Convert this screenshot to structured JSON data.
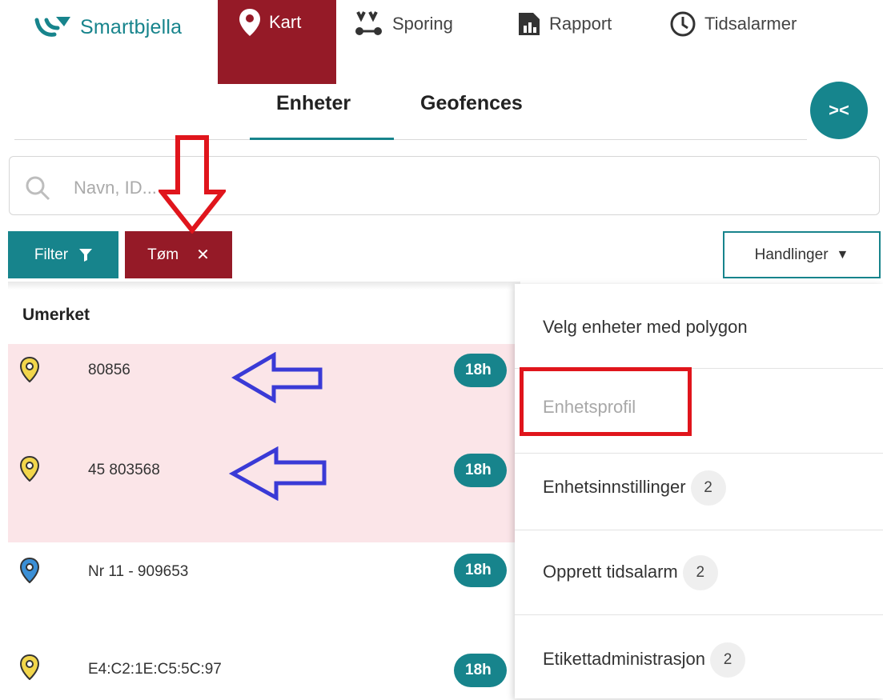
{
  "nav": {
    "logo_text": "Smartbjella",
    "items": [
      {
        "label": "Kart",
        "icon": "map-pin-icon"
      },
      {
        "label": "Sporing",
        "icon": "route-icon"
      },
      {
        "label": "Rapport",
        "icon": "report-icon"
      },
      {
        "label": "Tidsalarmer",
        "icon": "clock-icon"
      }
    ]
  },
  "tabs": [
    {
      "label": "Enheter",
      "active": true
    },
    {
      "label": "Geofences",
      "active": false
    }
  ],
  "collapse_label": "><",
  "search": {
    "placeholder": "Navn, ID..."
  },
  "buttons": {
    "filter": "Filter",
    "clear": "Tøm",
    "actions": "Handlinger"
  },
  "section_title": "Umerket",
  "units": [
    {
      "name": "80856",
      "badge": "18h",
      "pin_color": "#f2d64b",
      "highlighted": true
    },
    {
      "name": "45 803568",
      "badge": "18h",
      "pin_color": "#f2d64b",
      "highlighted": true
    },
    {
      "name": "Nr 11 - 909653",
      "badge": "18h",
      "pin_color": "#3a8fd6",
      "highlighted": false
    },
    {
      "name": "E4:C2:1E:C5:5C:97",
      "badge": "18h",
      "pin_color": "#f2d64b",
      "highlighted": false
    }
  ],
  "menu": [
    {
      "label": "Velg enheter med polygon",
      "count": null,
      "disabled": false
    },
    {
      "label": "Enhetsprofil",
      "count": null,
      "disabled": true
    },
    {
      "label": "Enhetsinnstillinger",
      "count": "2",
      "disabled": false
    },
    {
      "label": "Opprett tidsalarm",
      "count": "2",
      "disabled": false
    },
    {
      "label": "Etikettadministrasjon",
      "count": "2",
      "disabled": false
    }
  ],
  "colors": {
    "brand": "#17848c",
    "accent_red": "#951a27",
    "row_highlight": "#fbe5e8",
    "annotation_red": "#e0151c",
    "annotation_blue": "#3a3ad6"
  }
}
